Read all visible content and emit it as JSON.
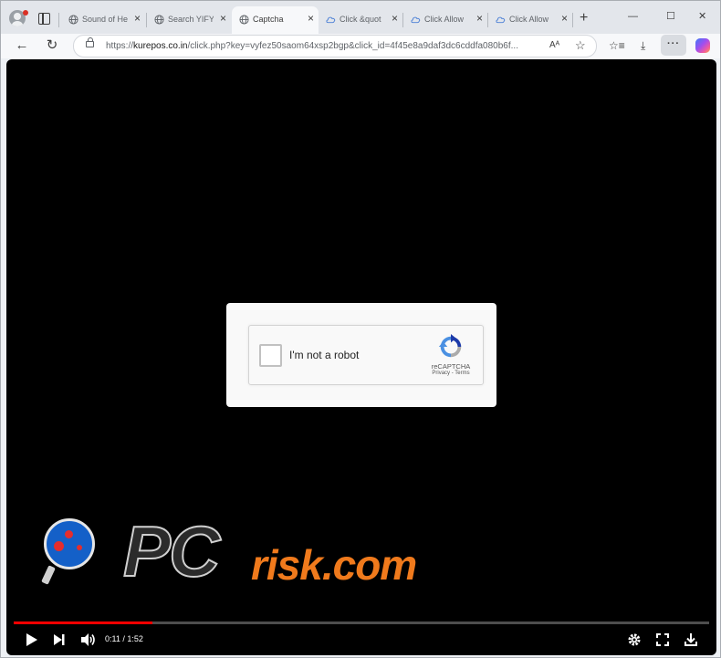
{
  "browser": {
    "tabs": [
      {
        "title": "Sound of He",
        "icon": "globe-icon",
        "active": false
      },
      {
        "title": "Search YIFY",
        "icon": "globe-icon",
        "active": false
      },
      {
        "title": "Captcha",
        "icon": "globe-icon",
        "active": true
      },
      {
        "title": "Click &quot",
        "icon": "cloud-icon",
        "active": false
      },
      {
        "title": "Click Allow",
        "icon": "cloud-icon",
        "active": false
      },
      {
        "title": "Click Allow",
        "icon": "cloud-icon",
        "active": false
      }
    ],
    "new_tab_symbol": "+",
    "window_controls": {
      "minimize": "—",
      "maximize": "☐",
      "close": "✕"
    },
    "address_bar": {
      "scheme": "https://",
      "host": "kurepos.co.in",
      "path": "/click.php?key=vyfez50saom64xsp2bgp&click_id=4f45e8a9daf3dc6cddfa080b6f..."
    },
    "toolbar": {
      "more_label": "···",
      "read_aloud_label": "Aᴬ"
    }
  },
  "recaptcha": {
    "checkbox_label": "I'm not a robot",
    "brand": "reCAPTCHA",
    "privacy_link": "Privacy",
    "link_separator": "-",
    "terms_link": "Terms"
  },
  "watermark": {
    "pc": "PC",
    "risk": "risk.com"
  },
  "player": {
    "current_time": "0:11",
    "duration": "1:52",
    "time_display": "0:11 / 1:52",
    "progress_fraction": 0.2
  },
  "colors": {
    "progress": "#ff0000",
    "watermark_orange": "#f07a1c",
    "recaptcha_blue": "#4a90e2"
  }
}
